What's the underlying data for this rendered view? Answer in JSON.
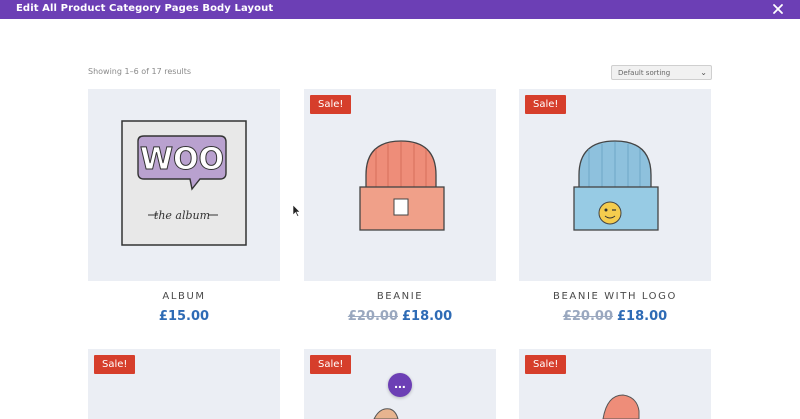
{
  "window": {
    "title": "Edit All Product Category Pages Body Layout"
  },
  "shop": {
    "result_count": "Showing 1–6 of 17 results",
    "sort_selected": "Default sorting"
  },
  "products": [
    {
      "name": "ALBUM",
      "price": "£15.00",
      "old_price": "",
      "sale": ""
    },
    {
      "name": "BEANIE",
      "price": "£18.00",
      "old_price": "£20.00",
      "sale": "Sale!"
    },
    {
      "name": "BEANIE WITH LOGO",
      "price": "£18.00",
      "old_price": "£20.00",
      "sale": "Sale!"
    },
    {
      "sale": "Sale!"
    },
    {
      "sale": "Sale!"
    },
    {
      "sale": "Sale!"
    }
  ],
  "album_art": {
    "logo_text": "WOO",
    "caption": "the    album"
  },
  "fab": {
    "label": "..."
  },
  "colors": {
    "brand_purple": "#6c3fb5",
    "sale_red": "#d63e2b",
    "price_blue": "#2e6bb5",
    "card_bg": "#ebeef4"
  }
}
